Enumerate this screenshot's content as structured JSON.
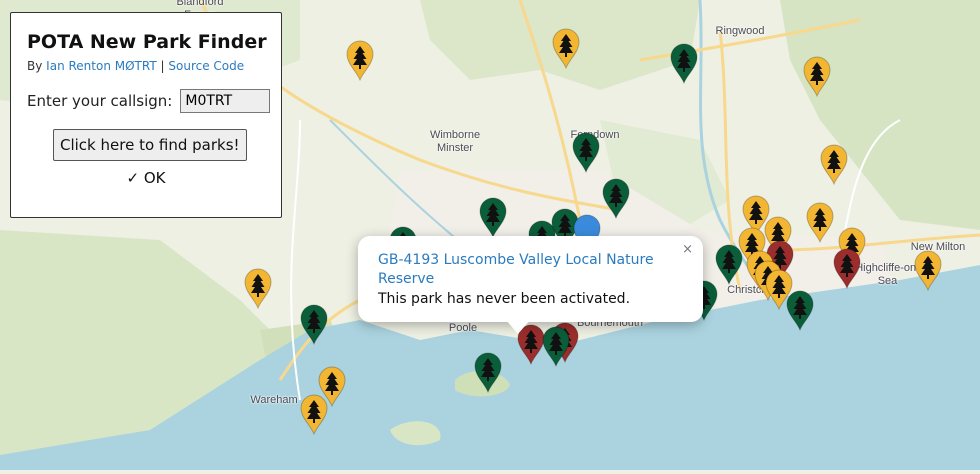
{
  "map": {
    "places": [
      "Blandford Forum",
      "Ringwood",
      "Wimborne Minster",
      "Ferndown",
      "New Milton",
      "Highcliffe-on-Sea",
      "Christchurch",
      "Poole",
      "Bournemouth",
      "Wareham"
    ],
    "colors": {
      "activated_green": "#0b5e3a",
      "unactivated_yellow": "#f2b632",
      "never_red": "#9b2d2d",
      "current_blue": "#3b8bdc"
    }
  },
  "panel": {
    "title": "POTA New Park Finder",
    "by_prefix": "By",
    "author": "Ian Renton MØTRT",
    "separator": "|",
    "source_link": "Source Code",
    "callsign_label": "Enter your callsign:",
    "callsign_value": "M0TRT",
    "find_button": "Click here to find parks!",
    "status_icon": "checkmark-icon",
    "status_text": "OK"
  },
  "popup": {
    "park_link": "GB-4193 Luscombe Valley Local Nature Reserve",
    "message": "This park has never been activated.",
    "close": "×"
  }
}
